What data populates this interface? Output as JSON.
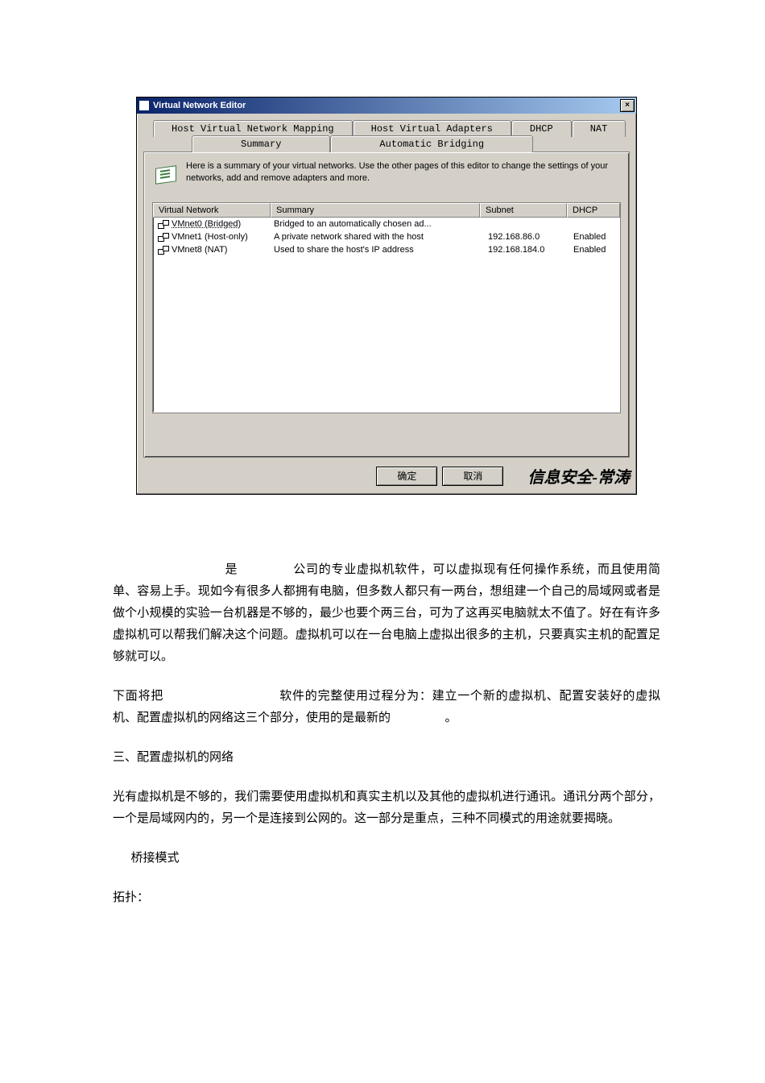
{
  "window": {
    "title": "Virtual Network Editor",
    "close": "×",
    "tabs_back": [
      "Host Virtual Network Mapping",
      "Host Virtual Adapters",
      "DHCP",
      "NAT"
    ],
    "tabs_front": [
      "Summary",
      "Automatic Bridging"
    ],
    "summary_text": "Here is a summary of your virtual networks. Use the other pages of this editor to change the settings of your networks, add and remove adapters and more.",
    "table": {
      "headers": {
        "network": "Virtual Network",
        "summary": "Summary",
        "subnet": "Subnet",
        "dhcp": "DHCP"
      },
      "rows": [
        {
          "network": "VMnet0 (Bridged)",
          "summary": "Bridged to an automatically chosen ad...",
          "subnet": "",
          "dhcp": ""
        },
        {
          "network": "VMnet1 (Host-only)",
          "summary": "A private network shared with the host",
          "subnet": "192.168.86.0",
          "dhcp": "Enabled"
        },
        {
          "network": "VMnet8 (NAT)",
          "summary": "Used to share the host's IP address",
          "subnet": "192.168.184.0",
          "dhcp": "Enabled"
        }
      ]
    },
    "buttons": {
      "ok": "确定",
      "cancel": "取消"
    },
    "watermark": "信息安全-常涛"
  },
  "article": {
    "p1_pre": "是",
    "p1": "公司的专业虚拟机软件，可以虚拟现有任何操作系统，而且使用简单、容易上手。现如今有很多人都拥有电脑，但多数人都只有一两台，想组建一个自己的局域网或者是做个小规模的实验一台机器是不够的，最少也要个两三台，可为了这再买电脑就太不值了。好在有许多虚拟机可以帮我们解决这个问题。虚拟机可以在一台电脑上虚拟出很多的主机，只要真实主机的配置足够就可以。",
    "p2_pre": "下面将把",
    "p2_mid": "软件的完整使用过程分为：建立一个新的虚拟机、配置安装好的虚拟机、配置虚拟机的网络这三个部分，使用的是最新的",
    "p2_end": "。",
    "h3": "三、配置虚拟机的网络",
    "p3": "光有虚拟机是不够的，我们需要使用虚拟机和真实主机以及其他的虚拟机进行通讯。通讯分两个部分，一个是局域网内的，另一个是连接到公网的。这一部分是重点，三种不同模式的用途就要揭晓。",
    "mode1": "桥接模式",
    "topo": "拓扑："
  }
}
